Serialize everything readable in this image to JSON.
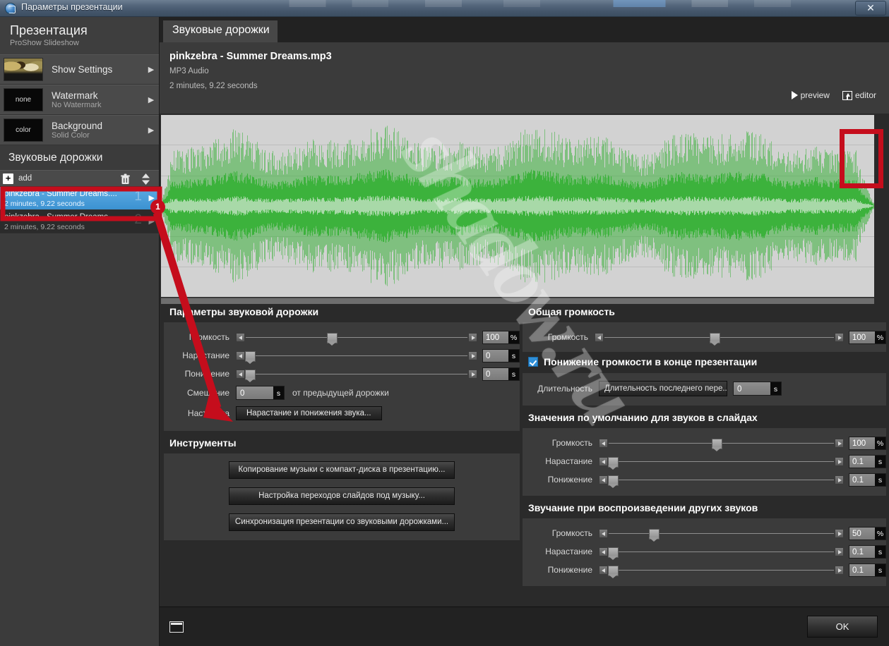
{
  "window": {
    "title": "Параметры презентации",
    "close_label": "✕",
    "icon": "proshow-app-icon"
  },
  "sidebar": {
    "title": "Презентация",
    "subtitle": "ProShow Slideshow",
    "items": [
      {
        "label": "Show Settings",
        "sublabel": "",
        "thumb": "slideshow-photo-thumbnail",
        "chevron": "▶"
      },
      {
        "label": "Watermark",
        "sublabel": "No Watermark",
        "thumb": "none",
        "chevron": "▶"
      },
      {
        "label": "Background",
        "sublabel": "Solid Color",
        "thumb": "color",
        "chevron": "▶"
      }
    ],
    "section_title": "Звуковые дорожки",
    "toolbar": {
      "add_label": "add",
      "trash_icon": "trash-icon",
      "sort_icon": "sort-updown-icon"
    },
    "tracks": [
      {
        "name": "pinkzebra - Summer Dreams....",
        "duration": "2 minutes, 9.22 seconds",
        "number": "1",
        "chevron": "▶",
        "selected": true
      },
      {
        "name": "pinkzebra - Summer Dreams....",
        "duration": "2 minutes, 9.22 seconds",
        "number": "2",
        "chevron": "▶",
        "selected": false
      }
    ]
  },
  "main": {
    "tab_label": "Звуковые дорожки",
    "file": {
      "name": "pinkzebra - Summer Dreams.mp3",
      "format": "MP3 Audio",
      "duration": "2 minutes, 9.22 seconds"
    },
    "actions": {
      "preview_label": "preview",
      "editor_label": "editor"
    },
    "watermark_text": "shadow.ru"
  },
  "track_params": {
    "title": "Параметры звуковой дорожки",
    "rows": [
      {
        "label": "Громкость",
        "value": "100",
        "unit": "%",
        "thumb_pct": 39
      },
      {
        "label": "Нарастание",
        "value": "0",
        "unit": "s",
        "thumb_pct": 1
      },
      {
        "label": "Понижение",
        "value": "0",
        "unit": "s",
        "thumb_pct": 1
      }
    ],
    "offset": {
      "label": "Смещение",
      "value": "0",
      "unit": "s",
      "after": "от предыдущей дорожки"
    },
    "config": {
      "label": "Настройка",
      "button": "Нарастание и понижения звука..."
    }
  },
  "tools": {
    "title": "Инструменты",
    "buttons": [
      "Копирование музыки с компакт-диска в презентацию...",
      "Настройка переходов слайдов под музыку...",
      "Синхронизация презентации со звуковыми дорожками..."
    ]
  },
  "overall_volume": {
    "title": "Общая громкость",
    "rows": [
      {
        "label": "Громкость",
        "value": "100",
        "unit": "%",
        "thumb_pct": 48
      }
    ],
    "fade_end": {
      "checked": true,
      "label": "Понижение громкости в конце презентации",
      "duration_label": "Длительность",
      "duration_value": "Длительность последнего пере...",
      "seconds_value": "0",
      "seconds_unit": "s"
    }
  },
  "slide_defaults": {
    "title": "Значения по умолчанию для звуков в слайдах",
    "rows": [
      {
        "label": "Громкость",
        "value": "100",
        "unit": "%",
        "thumb_pct": 48
      },
      {
        "label": "Нарастание",
        "value": "0.1",
        "unit": "s",
        "thumb_pct": 1
      },
      {
        "label": "Понижение",
        "value": "0.1",
        "unit": "s",
        "thumb_pct": 1
      }
    ]
  },
  "other_sounds": {
    "title": "Звучание при воспроизведении других звуков",
    "rows": [
      {
        "label": "Громкость",
        "value": "50",
        "unit": "%",
        "thumb_pct": 20
      },
      {
        "label": "Нарастание",
        "value": "0.1",
        "unit": "s",
        "thumb_pct": 1
      },
      {
        "label": "Понижение",
        "value": "0.1",
        "unit": "s",
        "thumb_pct": 1
      }
    ]
  },
  "footer": {
    "panel_icon": "panel-toggle-icon",
    "ok_label": "OK"
  },
  "annotations": {
    "badge_1": "1",
    "accent_color": "#c50d1c",
    "highlight_track_row": "selected audio track row 1",
    "highlight_waveform_end": "waveform fade-out region at end"
  },
  "colors": {
    "waveform_green": "#3cb23c",
    "waveform_bg": "#d2d2d2",
    "selection_blue": "#3f9bde",
    "checkbox_blue": "#2f8fd8",
    "panel_bg": "#3b3b3b",
    "app_bg": "#2a2a2a"
  }
}
